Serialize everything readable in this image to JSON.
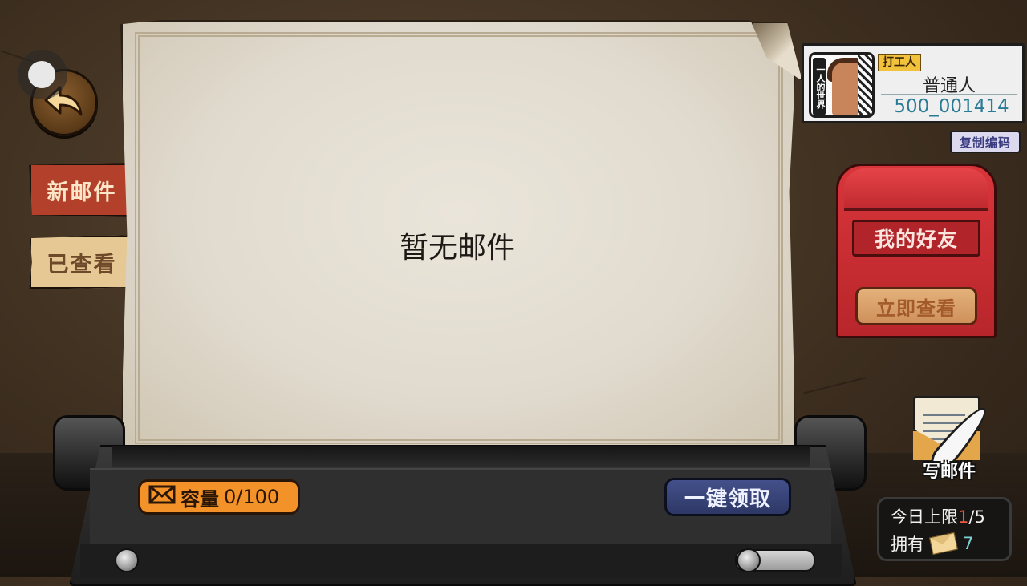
{
  "mail_list": {
    "empty_message": "暂无邮件"
  },
  "tabs": {
    "new_mail": "新邮件",
    "viewed": "已查看"
  },
  "player": {
    "avatar_caption": "一人的世界",
    "job_tag": "打工人",
    "rank": "普通人",
    "id": "500_001414",
    "copy_code_label": "复制编码"
  },
  "friends_box": {
    "title": "我的好友",
    "view_now_label": "立即查看"
  },
  "write_mail": {
    "label": "写邮件"
  },
  "capacity": {
    "label": "容量",
    "value": "0/100"
  },
  "claim_all_label": "一键领取",
  "daily": {
    "label": "今日上限",
    "used": "1",
    "total": "/5",
    "own_label": "拥有",
    "stamps": "7"
  },
  "icons": {
    "back": "back-arrow-icon",
    "envelope": "envelope-icon",
    "feather": "feather-quill-icon",
    "stamp": "mail-stamp-icon"
  },
  "colors": {
    "new_tab": "#b2402a",
    "viewed_tab": "#e6c894",
    "mailbox": "#d8353a",
    "capacity": "#f4922a",
    "claim_button": "#2e3866",
    "player_id": "#2a7b96",
    "limit_used": "#ef5a3c"
  }
}
